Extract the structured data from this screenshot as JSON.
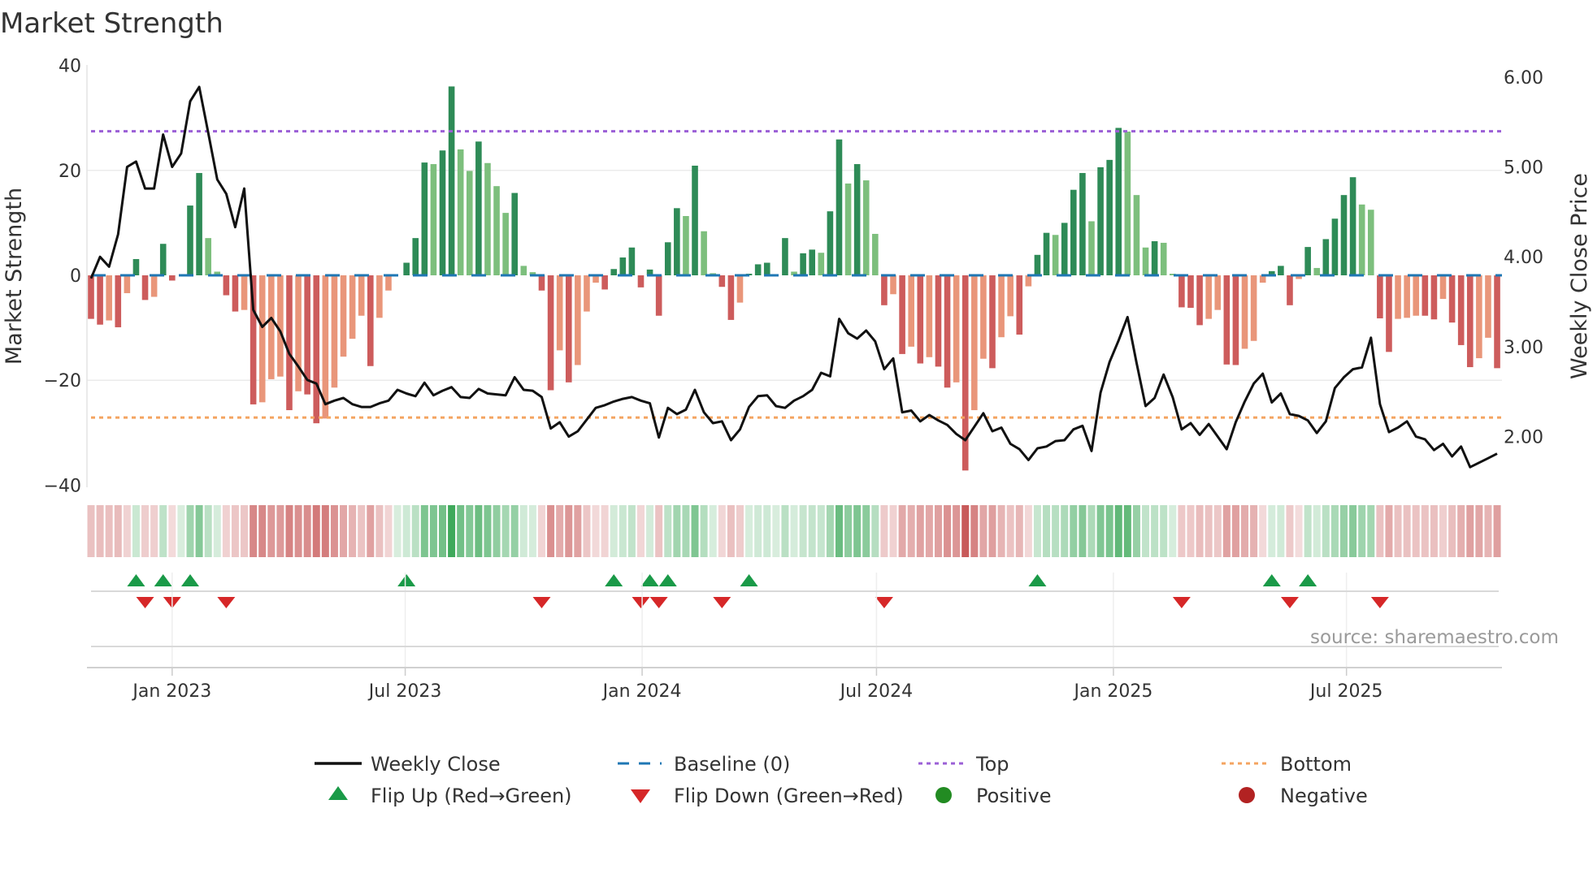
{
  "chart_data": {
    "type": "bar",
    "title": "Market Strength",
    "ylabel": "Market Strength",
    "y2label": "Weekly Close Price",
    "ylim": [
      -40,
      40
    ],
    "y2lim": [
      1.0,
      6.12
    ],
    "y_ticks": [
      40,
      20,
      0,
      -20,
      -40
    ],
    "y_tick_labels": [
      "40",
      "20",
      "0",
      "−20",
      "−40"
    ],
    "y2_ticks": [
      6,
      5,
      4,
      3,
      2
    ],
    "y2_tick_labels": [
      "6.00",
      "5.00",
      "4.00",
      "3.00",
      "2.00"
    ],
    "x_start": "2022-10-30",
    "x_interval": "weekly",
    "x_ticks": [
      {
        "date": "2023-01-01",
        "label": "Jan 2023"
      },
      {
        "date": "2023-07-01",
        "label": "Jul 2023"
      },
      {
        "date": "2024-01-01",
        "label": "Jan 2024"
      },
      {
        "date": "2024-07-01",
        "label": "Jul 2024"
      },
      {
        "date": "2025-01-01",
        "label": "Jan 2025"
      },
      {
        "date": "2025-07-01",
        "label": "Jul 2025"
      }
    ],
    "top_level": 27.45,
    "bottom_level": -27.1,
    "grid": true,
    "strength": [
      -8.3,
      -9.4,
      -8.6,
      -9.9,
      -3.4,
      3.1,
      -4.7,
      -4.1,
      6.0,
      -1.0,
      0,
      13.3,
      19.5,
      7.1,
      0.7,
      -3.8,
      -6.9,
      -6.6,
      -24.6,
      -24.2,
      -19.8,
      -19.3,
      -25.7,
      -22.1,
      -22.7,
      -28.2,
      -27.3,
      -21.4,
      -15.5,
      -12.1,
      -7.7,
      -17.3,
      -8.1,
      -2.9,
      0,
      2.4,
      7.1,
      21.5,
      21.2,
      23.8,
      36.0,
      24.0,
      19.9,
      25.5,
      21.4,
      17.0,
      11.9,
      15.7,
      1.8,
      0.6,
      -2.9,
      -21.9,
      -14.3,
      -20.4,
      -17.1,
      -6.9,
      -1.4,
      -2.7,
      1.2,
      3.4,
      5.3,
      -2.3,
      1.1,
      -7.7,
      6.3,
      12.8,
      11.3,
      20.9,
      8.4,
      0.4,
      -2.2,
      -8.5,
      -5.2,
      0.3,
      2.1,
      2.4,
      0,
      7.1,
      0.7,
      4.2,
      4.9,
      4.3,
      12.2,
      25.9,
      17.5,
      21.2,
      18.1,
      7.9,
      -5.7,
      -3.6,
      -15.0,
      -13.6,
      -16.8,
      -15.6,
      -17.4,
      -21.4,
      -20.4,
      -37.2,
      -25.7,
      -15.9,
      -17.7,
      -11.8,
      -7.8,
      -11.3,
      -2.1,
      3.9,
      8.1,
      7.7,
      10.0,
      16.3,
      19.5,
      10.3,
      20.6,
      22.0,
      28.1,
      27.4,
      15.3,
      5.3,
      6.5,
      6.2,
      0.3,
      -6.1,
      -6.2,
      -9.5,
      -8.3,
      -6.6,
      -17.0,
      -17.1,
      -14.0,
      -12.5,
      -1.4,
      0.8,
      1.8,
      -5.7,
      -0.7,
      5.4,
      1.4,
      6.9,
      10.8,
      15.3,
      18.7,
      13.5,
      12.5,
      -8.2,
      -14.6,
      -8.3,
      -8.1,
      -7.7,
      -7.7,
      -8.4,
      -4.5,
      -9.0,
      -13.3,
      -17.5,
      -15.8,
      -11.9,
      -17.7
    ],
    "weekly_close": [
      3.76,
      4.0,
      3.89,
      4.25,
      5.0,
      5.06,
      4.76,
      4.76,
      5.36,
      5.0,
      5.15,
      5.73,
      5.89,
      5.38,
      4.86,
      4.7,
      4.33,
      4.76,
      3.41,
      3.22,
      3.32,
      3.17,
      2.92,
      2.78,
      2.63,
      2.59,
      2.36,
      2.4,
      2.43,
      2.36,
      2.33,
      2.33,
      2.37,
      2.4,
      2.52,
      2.48,
      2.45,
      2.6,
      2.46,
      2.51,
      2.55,
      2.44,
      2.43,
      2.53,
      2.48,
      2.47,
      2.46,
      2.66,
      2.52,
      2.51,
      2.44,
      2.09,
      2.16,
      2.0,
      2.06,
      2.19,
      2.32,
      2.35,
      2.39,
      2.42,
      2.44,
      2.4,
      2.37,
      1.99,
      2.32,
      2.25,
      2.3,
      2.52,
      2.27,
      2.15,
      2.17,
      1.96,
      2.08,
      2.33,
      2.45,
      2.46,
      2.34,
      2.32,
      2.4,
      2.45,
      2.52,
      2.71,
      2.67,
      3.31,
      3.15,
      3.09,
      3.18,
      3.06,
      2.75,
      2.87,
      2.27,
      2.29,
      2.17,
      2.24,
      2.18,
      2.13,
      2.03,
      1.96,
      2.11,
      2.26,
      2.06,
      2.1,
      1.92,
      1.86,
      1.74,
      1.87,
      1.89,
      1.95,
      1.96,
      2.08,
      2.12,
      1.84,
      2.49,
      2.83,
      3.07,
      3.33,
      2.82,
      2.34,
      2.43,
      2.69,
      2.44,
      2.08,
      2.15,
      2.02,
      2.14,
      2.0,
      1.86,
      2.16,
      2.39,
      2.59,
      2.7,
      2.38,
      2.48,
      2.25,
      2.23,
      2.18,
      2.04,
      2.17,
      2.54,
      2.66,
      2.75,
      2.77,
      3.1,
      2.36,
      2.05,
      2.1,
      2.17,
      2.0,
      1.97,
      1.85,
      1.92,
      1.78,
      1.89,
      1.66,
      1.71,
      1.76,
      1.81
    ],
    "flip_up_weeks": [
      5,
      8,
      11,
      35,
      58,
      62,
      64,
      73,
      105,
      131,
      135
    ],
    "flip_down_weeks": [
      6,
      9,
      15,
      50,
      61,
      63,
      70,
      88,
      121,
      133,
      143
    ],
    "colors": {
      "green_strong": "#2e8b57",
      "green_weak": "#7dbf7d",
      "red_strong": "#cd5c5c",
      "red_weak": "#e9967a",
      "baseline": "#1f77b4",
      "top": "#9b5fd6",
      "bottom": "#f4a460",
      "line": "#111111",
      "flip_up": "#1a9a48",
      "flip_down": "#d62728",
      "heat_green": "#3aa757",
      "heat_red": "#c85a5a",
      "positive": "#228b22",
      "negative": "#b22222"
    },
    "legend": [
      {
        "key": "weekly_close",
        "label": "Weekly Close"
      },
      {
        "key": "baseline",
        "label": "Baseline (0)"
      },
      {
        "key": "top",
        "label": "Top"
      },
      {
        "key": "bottom",
        "label": "Bottom"
      },
      {
        "key": "flip_up",
        "label": "Flip Up (Red→Green)"
      },
      {
        "key": "flip_down",
        "label": "Flip Down (Green→Red)"
      },
      {
        "key": "positive",
        "label": "Positive"
      },
      {
        "key": "negative",
        "label": "Negative"
      }
    ],
    "legend_position": "bottom-center",
    "source": "source: sharemaestro.com"
  }
}
